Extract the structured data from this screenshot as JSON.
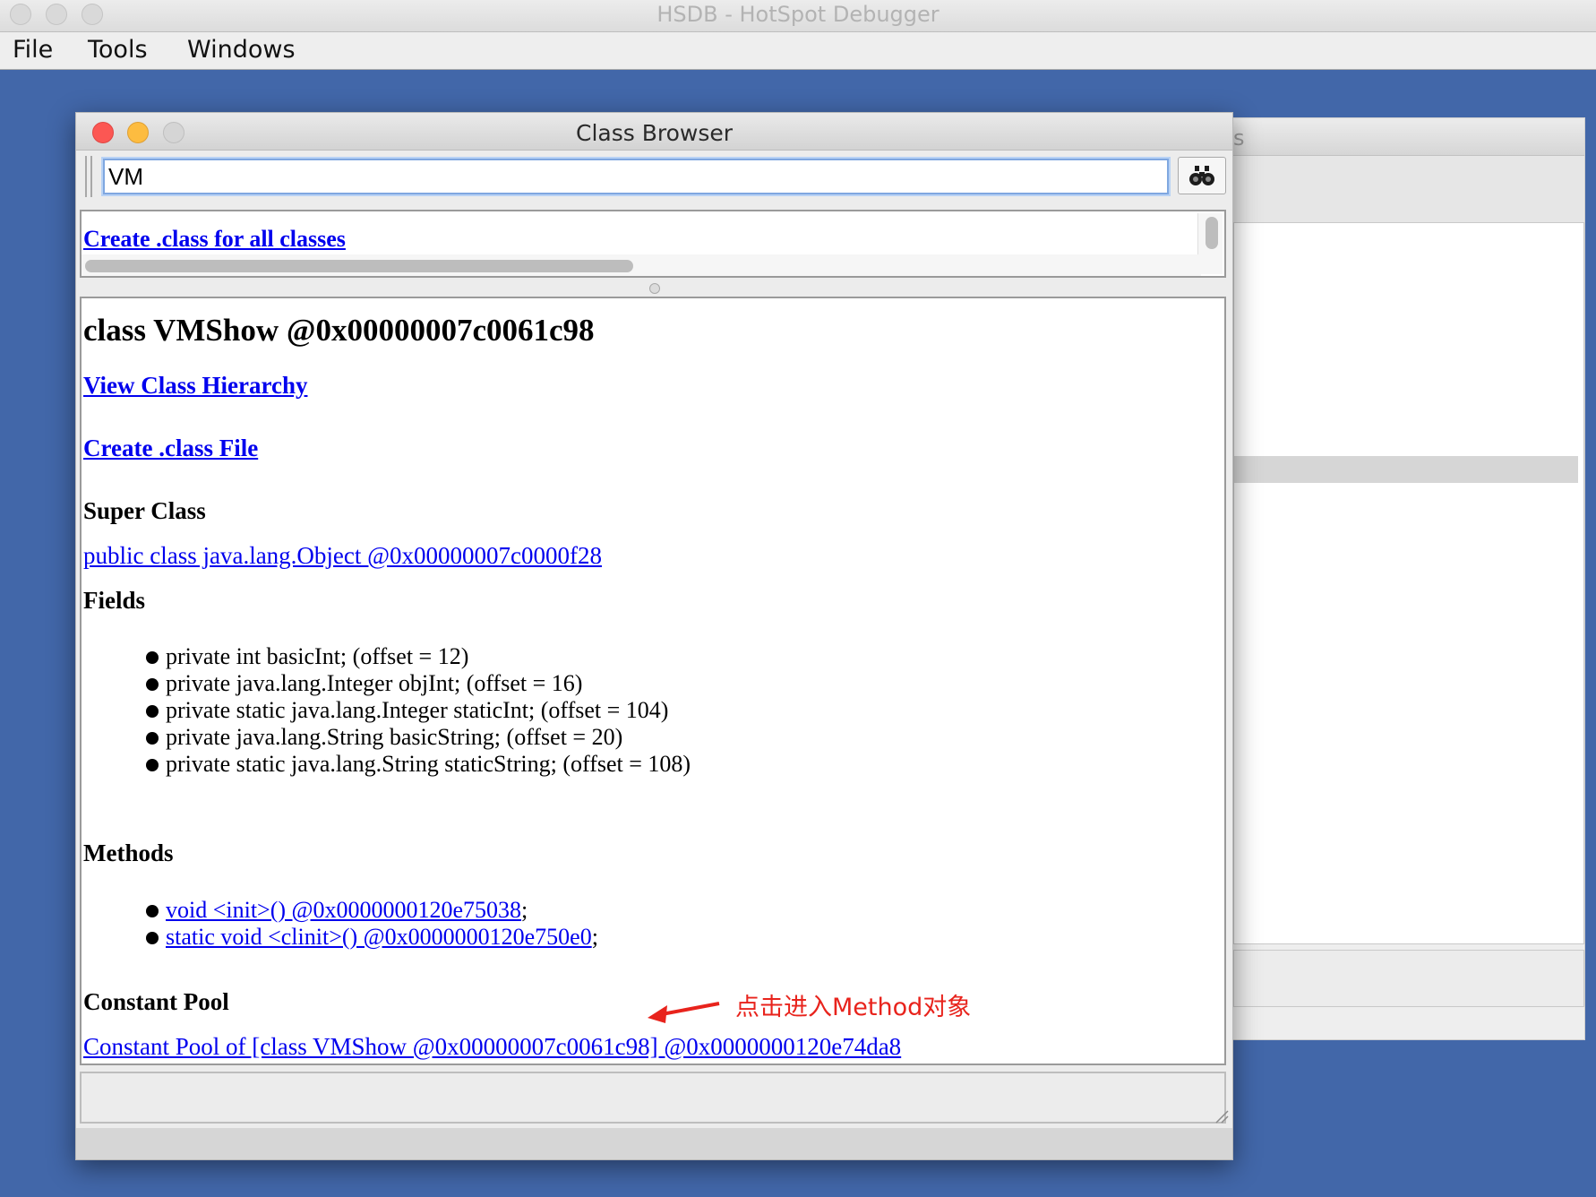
{
  "app": {
    "title": "HSDB - HotSpot Debugger",
    "menu": [
      "File",
      "Tools",
      "Windows"
    ]
  },
  "background_window": {
    "title_fragment": "s"
  },
  "class_browser": {
    "title": "Class Browser",
    "search_value": "VM",
    "top_list_link": "Create .class for all classes",
    "content": {
      "heading": "class VMShow @0x00000007c0061c98",
      "view_hierarchy_link": "View Class Hierarchy",
      "create_class_file_link": "Create .class File",
      "super_class_heading": "Super Class",
      "super_class_link": "public class java.lang.Object @0x00000007c0000f28",
      "fields_heading": "Fields",
      "fields": [
        "private int basicInt; (offset = 12)",
        "private java.lang.Integer objInt; (offset = 16)",
        "private static java.lang.Integer staticInt; (offset = 104)",
        "private java.lang.String basicString; (offset = 20)",
        "private static java.lang.String staticString; (offset = 108)"
      ],
      "methods_heading": "Methods",
      "methods": [
        {
          "link": "void <init>() @0x0000000120e75038",
          "suffix": ";"
        },
        {
          "link": "static void <clinit>() @0x0000000120e750e0",
          "suffix": ";"
        }
      ],
      "constant_pool_heading": "Constant Pool",
      "constant_pool_link": "Constant Pool of [class VMShow @0x00000007c0061c98] @0x0000000120e74da8"
    },
    "annotation": "点击进入Method对象"
  },
  "colors": {
    "desktop": "#4267a9",
    "link": "#0000ee",
    "annotation": "#e8231c",
    "close": "#fc5753",
    "minimize": "#fdbc40"
  }
}
